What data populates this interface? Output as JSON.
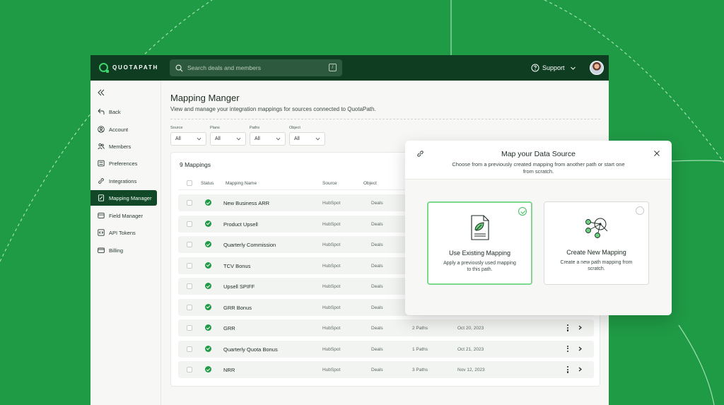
{
  "colors": {
    "background": "#1f9a45",
    "topbar": "#0e3d22",
    "accent": "#3fd36d",
    "active_nav": "#114827"
  },
  "brand": {
    "name": "QUOTAPATH"
  },
  "topbar": {
    "search_placeholder": "Search deals and members",
    "support_label": "Support"
  },
  "sidebar": {
    "items": [
      {
        "label": "Back",
        "icon": "back-arrow-icon"
      },
      {
        "label": "Account",
        "icon": "user-circle-icon"
      },
      {
        "label": "Members",
        "icon": "users-icon"
      },
      {
        "label": "Preferences",
        "icon": "sliders-icon"
      },
      {
        "label": "Integrations",
        "icon": "link-icon"
      },
      {
        "label": "Mapping Manager",
        "icon": "document-edit-icon",
        "active": true
      },
      {
        "label": "Field Manager",
        "icon": "field-icon"
      },
      {
        "label": "API Tokens",
        "icon": "code-icon"
      },
      {
        "label": "Billing",
        "icon": "credit-card-icon"
      }
    ]
  },
  "page": {
    "title": "Mapping Manger",
    "subtitle": "View and manage your integration mappings for sources connected to QuotaPath."
  },
  "filters": [
    {
      "label": "Source",
      "value": "All"
    },
    {
      "label": "Plans",
      "value": "All"
    },
    {
      "label": "Paths",
      "value": "All"
    },
    {
      "label": "Object",
      "value": "All"
    }
  ],
  "table": {
    "title": "9 Mappings",
    "columns": {
      "status": "Status",
      "name": "Mapping Name",
      "source": "Source",
      "object": "Object"
    },
    "rows": [
      {
        "name": "New Business ARR",
        "source": "HubSpot",
        "object": "Deals",
        "paths": "",
        "date": ""
      },
      {
        "name": "Product Upsell",
        "source": "HubSpot",
        "object": "Deals",
        "paths": "",
        "date": ""
      },
      {
        "name": "Quarterly Commission",
        "source": "HubSpot",
        "object": "Deals",
        "paths": "",
        "date": ""
      },
      {
        "name": "TCV Bonus",
        "source": "HubSpot",
        "object": "Deals",
        "paths": "",
        "date": ""
      },
      {
        "name": "Upsell SPIFF",
        "source": "HubSpot",
        "object": "Deals",
        "paths": "",
        "date": ""
      },
      {
        "name": "GRR Bonus",
        "source": "HubSpot",
        "object": "Deals",
        "paths": "",
        "date": ""
      },
      {
        "name": "GRR",
        "source": "HubSpot",
        "object": "Deals",
        "paths": "2 Paths",
        "date": "Oct 20, 2023"
      },
      {
        "name": "Quarterly Quota Bonus",
        "source": "HubSpot",
        "object": "Deals",
        "paths": "1 Paths",
        "date": "Oct 21, 2023"
      },
      {
        "name": "NRR",
        "source": "HubSpot",
        "object": "Deals",
        "paths": "3 Paths",
        "date": "Nov 12, 2023"
      }
    ]
  },
  "modal": {
    "title": "Map your Data Source",
    "description": "Choose from a previously created mapping from another path or start one from scratch.",
    "options": [
      {
        "title": "Use Existing Mapping",
        "description": "Apply a previously used mapping to this path.",
        "selected": true,
        "icon": "document-leaf-icon"
      },
      {
        "title": "Create New Mapping",
        "description": "Create a new path mapping from scratch.",
        "selected": false,
        "icon": "network-nodes-icon"
      }
    ]
  }
}
